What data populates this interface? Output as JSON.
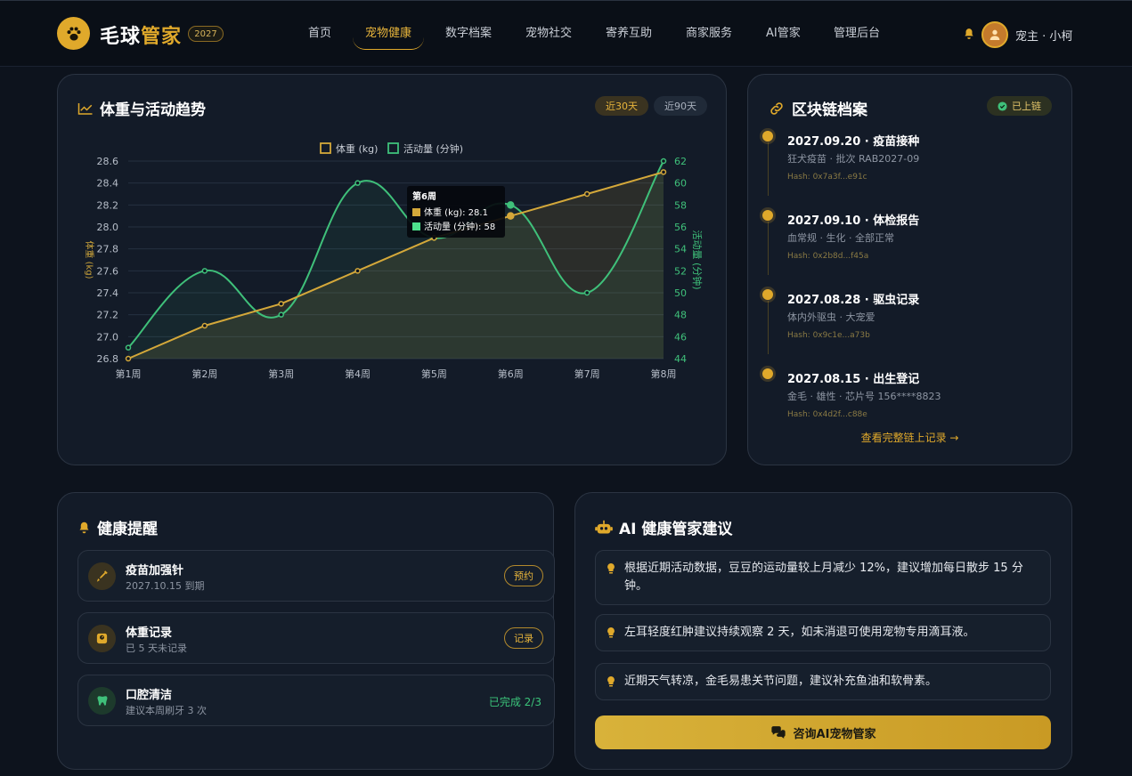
{
  "app": {
    "brand_main": "毛球",
    "brand_accent": "管家",
    "year": "2027"
  },
  "nav": {
    "items": [
      {
        "label": "首页"
      },
      {
        "label": "宠物健康"
      },
      {
        "label": "数字档案"
      },
      {
        "label": "宠物社交"
      },
      {
        "label": "寄养互助"
      },
      {
        "label": "商家服务"
      },
      {
        "label": "AI管家"
      },
      {
        "label": "管理后台"
      }
    ],
    "active_index": 1
  },
  "user": {
    "name": "宠主 · 小柯"
  },
  "trend": {
    "title": "体重与活动趋势",
    "range_30": "近30天",
    "range_90": "近90天"
  },
  "chart_data": {
    "type": "line",
    "categories": [
      "第1周",
      "第2周",
      "第3周",
      "第4周",
      "第5周",
      "第6周",
      "第7周",
      "第8周"
    ],
    "series": [
      {
        "name": "体重 (kg)",
        "axis": "left",
        "values": [
          26.8,
          27.1,
          27.3,
          27.6,
          27.9,
          28.1,
          28.3,
          28.5
        ],
        "color": "#d4a83a"
      },
      {
        "name": "活动量 (分钟)",
        "axis": "right",
        "values": [
          45,
          52,
          48,
          60,
          55,
          58,
          50,
          62
        ],
        "color": "#3fc07a"
      }
    ],
    "ylabel": "体重 (kg)",
    "y2label": "活动量 (分钟)",
    "ylim": [
      26.8,
      28.6
    ],
    "yticks": [
      "26.8",
      "27.0",
      "27.2",
      "27.4",
      "27.6",
      "27.8",
      "28.0",
      "28.2",
      "28.4",
      "28.6"
    ],
    "y2lim": [
      44,
      62
    ],
    "y2ticks": [
      "44",
      "46",
      "48",
      "50",
      "52",
      "54",
      "56",
      "58",
      "60",
      "62"
    ],
    "legend": "top",
    "grid": true,
    "tooltip": {
      "title": "第6周",
      "line1": "体重 (kg): 28.1",
      "line2": "活动量 (分钟): 58"
    }
  },
  "chain": {
    "title": "区块链档案",
    "status": "已上链",
    "records": [
      {
        "title": "2027.09.20 · 疫苗接种",
        "desc": "狂犬疫苗 · 批次 RAB2027-09",
        "hash": "Hash: 0x7a3f...e91c"
      },
      {
        "title": "2027.09.10 · 体检报告",
        "desc": "血常规 · 生化 · 全部正常",
        "hash": "Hash: 0x2b8d...f45a"
      },
      {
        "title": "2027.08.28 · 驱虫记录",
        "desc": "体内外驱虫 · 大宠爱",
        "hash": "Hash: 0x9c1e...a73b"
      },
      {
        "title": "2027.08.15 · 出生登记",
        "desc": "金毛 · 雄性 · 芯片号 156****8823",
        "hash": "Hash: 0x4d2f...c88e"
      }
    ],
    "view_all": "查看完整链上记录 →"
  },
  "reminders": {
    "title": "健康提醒",
    "items": [
      {
        "title": "疫苗加强针",
        "sub": "2027.10.15 到期",
        "action": "预约"
      },
      {
        "title": "体重记录",
        "sub": "已 5 天未记录",
        "action": "记录"
      },
      {
        "title": "口腔清洁",
        "sub": "建议本周刷牙 3 次",
        "status": "已完成 2/3"
      }
    ]
  },
  "ai": {
    "title": "AI 健康管家建议",
    "advices": [
      "根据近期活动数据，豆豆的运动量较上月减少 12%，建议增加每日散步 15 分钟。",
      "左耳轻度红肿建议持续观察 2 天，如未消退可使用宠物专用滴耳液。",
      "近期天气转凉，金毛易患关节问题，建议补充鱼油和软骨素。"
    ],
    "cta": "咨询AI宠物管家"
  }
}
